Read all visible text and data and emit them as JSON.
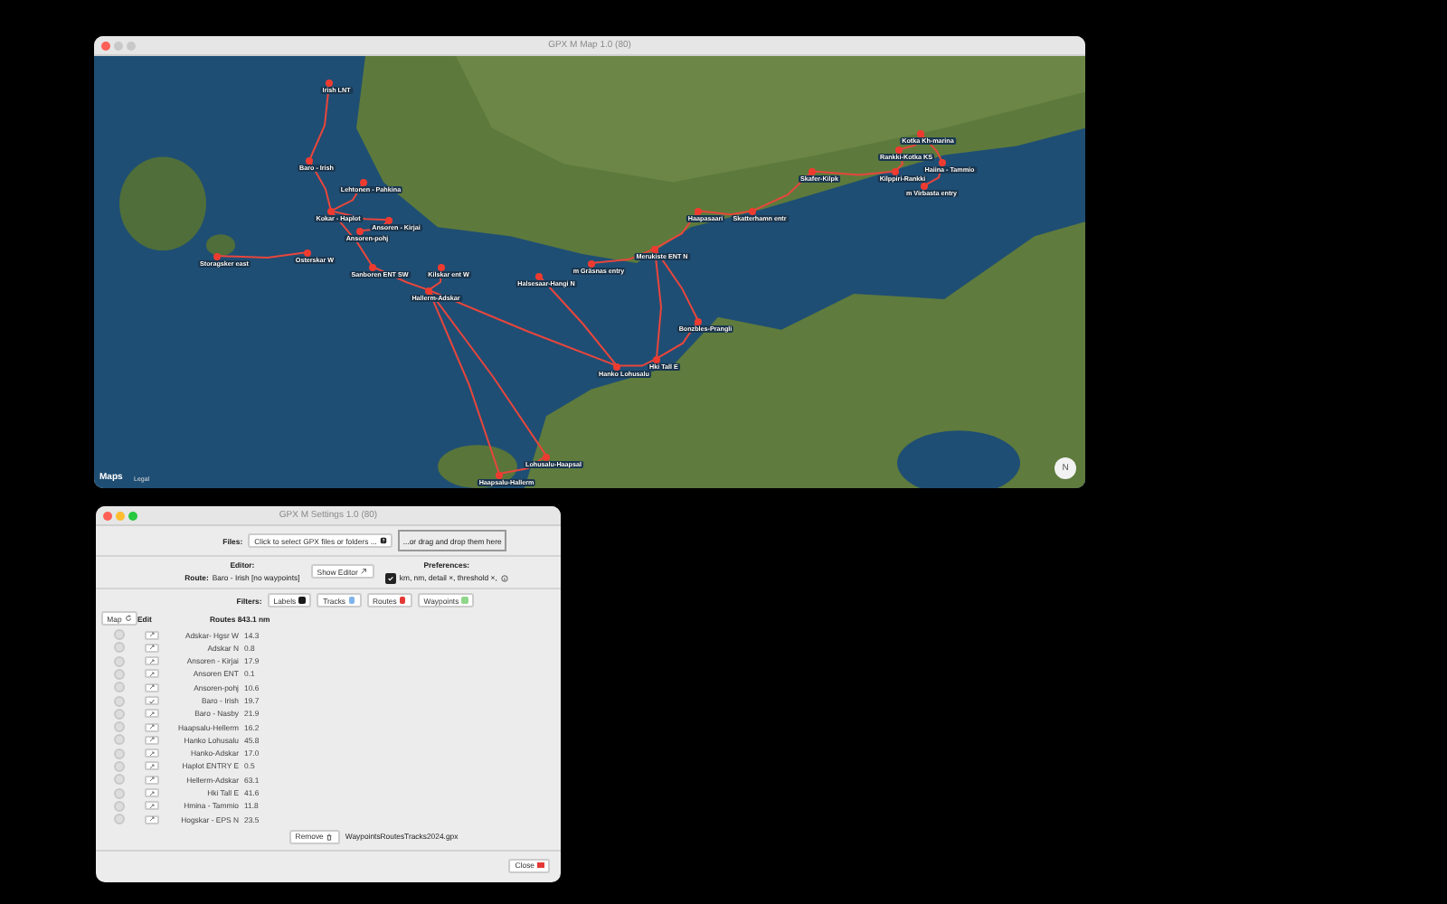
{
  "map_window": {
    "title": "GPX M Map 1.0 (80)",
    "labels": [
      "Irish LNT",
      "Baro - Irish",
      "Lehtonen - Pahkina",
      "Kokar - Haplot",
      "Ansoren - Kirjai",
      "Ansoren-pohj",
      "Storagsker east",
      "Osterskar W",
      "Haapasaari",
      "Skatterhamn entr",
      "Skafer-Kilpk",
      "Kotka Kh-marina",
      "Rankki-Kotka KS",
      "Haiina - Tammio",
      "Kilppiri-Rankki",
      "m Virbasta entry",
      "Merukiste ENT N",
      "Sanboren ENT SW",
      "Kilskar ent W",
      "m Gräsnas entry",
      "Hallerm-Adskar",
      "Halsesaar-Hangi N",
      "Bonzbles-Prangli",
      "Hki Tall E",
      "Hanko Lohusalu",
      "Lohusalu-Haapsal",
      "Haapsalu-Hallerm"
    ],
    "attribution": {
      "logo": "Maps",
      "legal": "Legal"
    },
    "compass": "N"
  },
  "settings_window": {
    "title": "GPX M Settings 1.0 (80)",
    "files": {
      "label": "Files:",
      "button": "Click to select GPX files or folders ...",
      "drop_zone": "...or drag and drop them here"
    },
    "editor": {
      "heading": "Editor:",
      "route_label": "Route:",
      "route_value": "Baro - Irish  [no waypoints]",
      "button": "Show Editor"
    },
    "preferences": {
      "heading": "Preferences:",
      "checked": true,
      "text": "km, nm, detail ×, threshold ×,"
    },
    "filters": {
      "label": "Filters:",
      "items": [
        {
          "label": "Labels",
          "color": "#1a1a1a"
        },
        {
          "label": "Tracks",
          "color": "#7fb3ea"
        },
        {
          "label": "Routes",
          "color": "#e53935"
        },
        {
          "label": "Waypoints",
          "color": "#8fd68a"
        }
      ]
    },
    "table": {
      "columns": [
        "Map",
        "Edit",
        "Routes 843.1 nm"
      ],
      "rows": [
        {
          "name": "Adskar- Hgsr W",
          "distance": "14.3",
          "on_map": false,
          "editing": false
        },
        {
          "name": "Adskar N",
          "distance": "0.8",
          "on_map": false,
          "editing": false
        },
        {
          "name": "Ansoren - Kirjai",
          "distance": "17.9",
          "on_map": false,
          "editing": false
        },
        {
          "name": "Ansoren ENT",
          "distance": "0.1",
          "on_map": false,
          "editing": false
        },
        {
          "name": "Ansoren-pohj",
          "distance": "10.6",
          "on_map": false,
          "editing": false
        },
        {
          "name": "Baro - Irish",
          "distance": "19.7",
          "on_map": false,
          "editing": true
        },
        {
          "name": "Baro - Nasby",
          "distance": "21.9",
          "on_map": false,
          "editing": false
        },
        {
          "name": "Haapsalu-Hellerm",
          "distance": "16.2",
          "on_map": false,
          "editing": false
        },
        {
          "name": "Hanko Lohusalu",
          "distance": "45.8",
          "on_map": false,
          "editing": false
        },
        {
          "name": "Hanko-Adskar",
          "distance": "17.0",
          "on_map": false,
          "editing": false
        },
        {
          "name": "Haplot ENTRY E",
          "distance": "0.5",
          "on_map": false,
          "editing": false
        },
        {
          "name": "Hellerm-Adskar",
          "distance": "63.1",
          "on_map": false,
          "editing": false
        },
        {
          "name": "Hki Tall E",
          "distance": "41.6",
          "on_map": false,
          "editing": false
        },
        {
          "name": "Hmina - Tammio",
          "distance": "11.8",
          "on_map": false,
          "editing": false
        },
        {
          "name": "Hogskar - EPS N",
          "distance": "23.5",
          "on_map": false,
          "editing": false
        }
      ]
    },
    "footer": {
      "remove_button": "Remove",
      "file": "WaypointsRoutesTracks2024.gpx"
    },
    "close_button": "Close"
  }
}
